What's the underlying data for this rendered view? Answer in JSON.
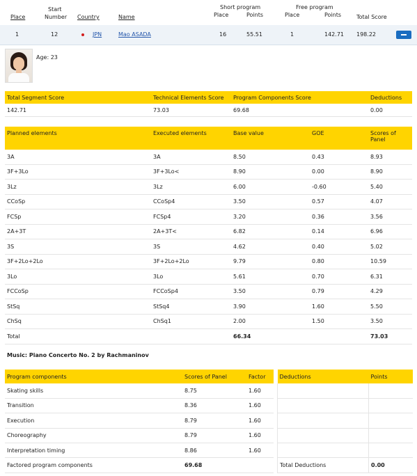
{
  "header": {
    "place": "Place",
    "start_number_line1": "Start",
    "start_number_line2": "Number",
    "country": "Country",
    "name": "Name",
    "short_program": "Short program",
    "free_program": "Free program",
    "sp_place": "Place",
    "sp_points": "Points",
    "fp_place": "Place",
    "fp_points": "Points",
    "total_score": "Total Score"
  },
  "skater": {
    "place": "1",
    "start_number": "12",
    "country": "JPN",
    "name": "Mao ASADA",
    "sp_place": "16",
    "sp_points": "55.51",
    "fp_place": "1",
    "fp_points": "142.71",
    "total": "198.22",
    "age": "Age: 23",
    "flag_color": "#d21d1d"
  },
  "summary": {
    "headers": [
      "Total Segment Score",
      "Technical Elements Score",
      "Program Components Score",
      "Deductions"
    ],
    "values": [
      "142.71",
      "73.03",
      "69.68",
      "0.00"
    ]
  },
  "elements": {
    "headers": [
      "Planned elements",
      "Executed elements",
      "Base value",
      "GOE",
      "Scores of Panel"
    ],
    "rows": [
      [
        "3A",
        "3A",
        "8.50",
        "0.43",
        "8.93"
      ],
      [
        "3F+3Lo",
        "3F+3Lo<",
        "8.90",
        "0.00",
        "8.90"
      ],
      [
        "3Lz",
        "3Lz",
        "6.00",
        "-0.60",
        "5.40"
      ],
      [
        "CCoSp",
        "CCoSp4",
        "3.50",
        "0.57",
        "4.07"
      ],
      [
        "FCSp",
        "FCSp4",
        "3.20",
        "0.36",
        "3.56"
      ],
      [
        "2A+3T",
        "2A+3T<",
        "6.82",
        "0.14",
        "6.96"
      ],
      [
        "3S",
        "3S",
        "4.62",
        "0.40",
        "5.02"
      ],
      [
        "3F+2Lo+2Lo",
        "3F+2Lo+2Lo",
        "9.79",
        "0.80",
        "10.59"
      ],
      [
        "3Lo",
        "3Lo",
        "5.61",
        "0.70",
        "6.31"
      ],
      [
        "FCCoSp",
        "FCCoSp4",
        "3.50",
        "0.79",
        "4.29"
      ],
      [
        "StSq",
        "StSq4",
        "3.90",
        "1.60",
        "5.50"
      ],
      [
        "ChSq",
        "ChSq1",
        "2.00",
        "1.50",
        "3.50"
      ]
    ],
    "total_label": "Total",
    "total_base": "66.34",
    "total_panel": "73.03"
  },
  "music": "Music: Piano Concerto No. 2 by Rachmaninov",
  "components": {
    "headers": [
      "Program components",
      "Scores of Panel",
      "Factor"
    ],
    "rows": [
      [
        "Skating skills",
        "8.75",
        "1.60"
      ],
      [
        "Transition",
        "8.36",
        "1.60"
      ],
      [
        "Execution",
        "8.79",
        "1.60"
      ],
      [
        "Choreography",
        "8.79",
        "1.60"
      ],
      [
        "Interpretation timing",
        "8.86",
        "1.60"
      ]
    ],
    "factored_label": "Factored program components",
    "factored_value": "69.68"
  },
  "deductions": {
    "headers": [
      "Deductions",
      "Points"
    ],
    "total_label": "Total Deductions",
    "total_value": "0.00"
  }
}
